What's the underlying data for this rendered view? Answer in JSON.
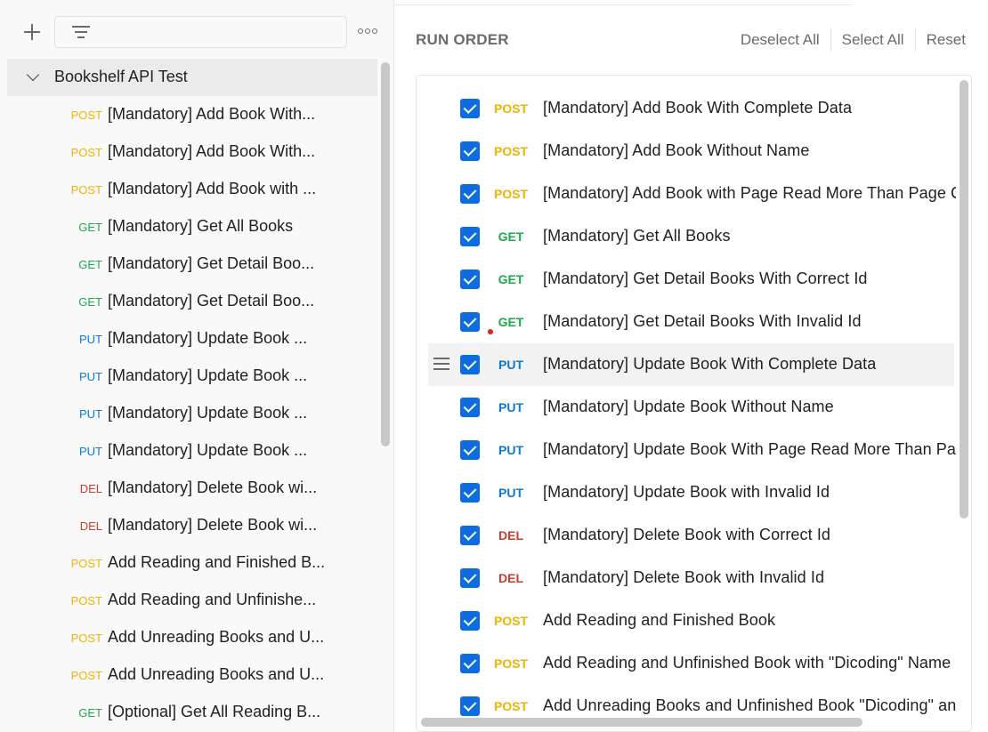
{
  "sidebar": {
    "collection_name": "Bookshelf API Test",
    "requests": [
      {
        "method": "POST",
        "name": "[Mandatory] Add Book With..."
      },
      {
        "method": "POST",
        "name": "[Mandatory] Add Book With..."
      },
      {
        "method": "POST",
        "name": "[Mandatory] Add Book with ..."
      },
      {
        "method": "GET",
        "name": "[Mandatory] Get All Books"
      },
      {
        "method": "GET",
        "name": "[Mandatory] Get Detail Boo..."
      },
      {
        "method": "GET",
        "name": "[Mandatory] Get Detail Boo..."
      },
      {
        "method": "PUT",
        "name": "[Mandatory] Update Book ..."
      },
      {
        "method": "PUT",
        "name": "[Mandatory] Update Book ..."
      },
      {
        "method": "PUT",
        "name": "[Mandatory] Update Book ..."
      },
      {
        "method": "PUT",
        "name": "[Mandatory] Update Book ..."
      },
      {
        "method": "DEL",
        "name": "[Mandatory] Delete Book wi..."
      },
      {
        "method": "DEL",
        "name": "[Mandatory] Delete Book wi..."
      },
      {
        "method": "POST",
        "name": "Add Reading and Finished B..."
      },
      {
        "method": "POST",
        "name": "Add Reading and Unfinishe..."
      },
      {
        "method": "POST",
        "name": "Add Unreading Books and U..."
      },
      {
        "method": "POST",
        "name": "Add Unreading Books and U..."
      },
      {
        "method": "GET",
        "name": "[Optional] Get All Reading B..."
      }
    ]
  },
  "run_order": {
    "title": "RUN ORDER",
    "actions": {
      "deselect_all": "Deselect All",
      "select_all": "Select All",
      "reset": "Reset"
    },
    "items": [
      {
        "method": "POST",
        "name": "[Mandatory] Add Book With Complete Data",
        "checked": true
      },
      {
        "method": "POST",
        "name": "[Mandatory] Add Book Without Name",
        "checked": true
      },
      {
        "method": "POST",
        "name": "[Mandatory] Add Book with Page Read More Than Page Count",
        "checked": true
      },
      {
        "method": "GET",
        "name": "[Mandatory] Get All Books",
        "checked": true
      },
      {
        "method": "GET",
        "name": "[Mandatory] Get Detail Books With Correct Id",
        "checked": true
      },
      {
        "method": "GET",
        "name": "[Mandatory] Get Detail Books With Invalid Id",
        "checked": true
      },
      {
        "method": "PUT",
        "name": "[Mandatory] Update Book With Complete Data",
        "checked": true
      },
      {
        "method": "PUT",
        "name": "[Mandatory] Update Book Without Name",
        "checked": true
      },
      {
        "method": "PUT",
        "name": "[Mandatory] Update Book With Page Read More Than Page Count",
        "checked": true
      },
      {
        "method": "PUT",
        "name": "[Mandatory] Update Book with Invalid Id",
        "checked": true
      },
      {
        "method": "DEL",
        "name": "[Mandatory] Delete Book with Correct Id",
        "checked": true
      },
      {
        "method": "DEL",
        "name": "[Mandatory] Delete Book with Invalid Id",
        "checked": true
      },
      {
        "method": "POST",
        "name": "Add Reading and Finished Book",
        "checked": true
      },
      {
        "method": "POST",
        "name": "Add Reading and Unfinished Book with \"Dicoding\" Name",
        "checked": true
      },
      {
        "method": "POST",
        "name": "Add Unreading Books and Unfinished Book \"Dicoding\" and \"Dicoding\"",
        "checked": true
      }
    ]
  },
  "colors": {
    "POST": "#f2b200",
    "GET": "#1faa4f",
    "PUT": "#0a7ad7",
    "DEL": "#d03a31",
    "checkbox": "#0c6de0"
  }
}
